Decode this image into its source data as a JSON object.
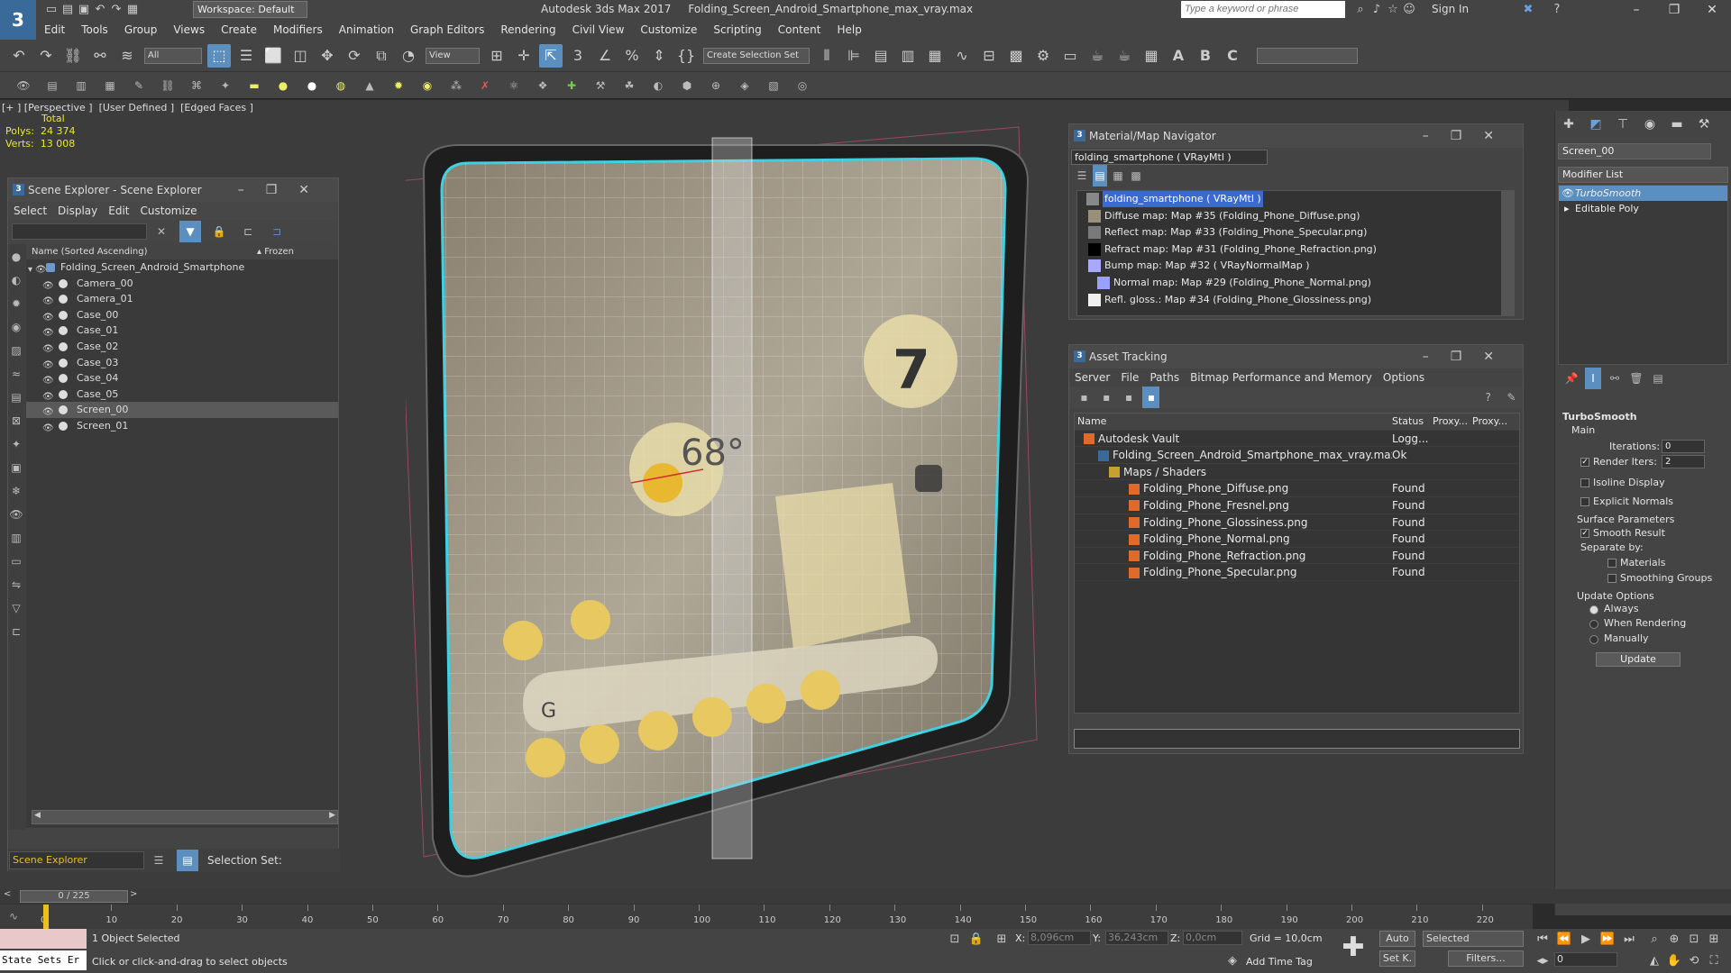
{
  "app": {
    "title": "Autodesk 3ds Max 2017     Folding_Screen_Android_Smartphone_max_vray.max",
    "logo": "3",
    "workspace": "Workspace: Default",
    "search_placeholder": "Type a keyword or phrase",
    "sign_in": "Sign In",
    "accent": "#5b8fbf"
  },
  "menu": [
    "Edit",
    "Tools",
    "Group",
    "Views",
    "Create",
    "Modifiers",
    "Animation",
    "Graph Editors",
    "Rendering",
    "Civil View",
    "Customize",
    "Scripting",
    "Content",
    "Help"
  ],
  "toolbar": {
    "filter": "All",
    "view": "View",
    "selection_set": "Create Selection Set"
  },
  "viewport": {
    "label": "[+ ] [Perspective ]  [User Defined ]  [Edged Faces ]",
    "stats_total": "Total",
    "polys_label": "Polys:",
    "polys_value": "24 374",
    "verts_label": "Verts:",
    "verts_value": "13 008",
    "screen": {
      "temp": "68°",
      "clock": "7",
      "search_g": "G"
    }
  },
  "scene_explorer": {
    "title": "Scene Explorer - Scene Explorer",
    "menu": [
      "Select",
      "Display",
      "Edit",
      "Customize"
    ],
    "col_name": "Name (Sorted Ascending)",
    "col_frozen": "▴ Frozen",
    "root": "Folding_Screen_Android_Smartphone",
    "items": [
      "Camera_00",
      "Camera_01",
      "Case_00",
      "Case_01",
      "Case_02",
      "Case_03",
      "Case_04",
      "Case_05",
      "Screen_00",
      "Screen_01"
    ],
    "selected_item": "Screen_00",
    "footer_label": "Scene Explorer",
    "selection_set_label": "Selection Set:"
  },
  "material_navigator": {
    "title": "Material/Map Navigator",
    "material_field": "folding_smartphone  ( VRayMtl )",
    "root": "folding_smartphone  ( VRayMtl )",
    "items": [
      {
        "text": "Diffuse map: Map #35 (Folding_Phone_Diffuse.png)",
        "swatch": "#9a8f7a"
      },
      {
        "text": "Reflect map: Map #33 (Folding_Phone_Specular.png)",
        "swatch": "#7a7a7a"
      },
      {
        "text": "Refract map: Map #31 (Folding_Phone_Refraction.png)",
        "swatch": "#000000"
      },
      {
        "text": "Bump map: Map #32  ( VRayNormalMap )",
        "swatch": "#a8a8ff"
      },
      {
        "text": "Normal map: Map #29 (Folding_Phone_Normal.png)",
        "swatch": "#9aa0ff"
      },
      {
        "text": "Refl. gloss.: Map #34 (Folding_Phone_Glossiness.png)",
        "swatch": "#f0f0f0"
      }
    ]
  },
  "asset_tracking": {
    "title": "Asset Tracking",
    "menu": [
      "Server",
      "File",
      "Paths",
      "Bitmap Performance and Memory",
      "Options"
    ],
    "columns": [
      "Name",
      "Status",
      "Proxy...",
      "Proxy..."
    ],
    "rows": [
      {
        "name": "Autodesk Vault",
        "status": "Logg...",
        "indent": 0
      },
      {
        "name": "Folding_Screen_Android_Smartphone_max_vray.max",
        "status": "Ok",
        "indent": 1
      },
      {
        "name": "Maps / Shaders",
        "status": "",
        "indent": 2
      },
      {
        "name": "Folding_Phone_Diffuse.png",
        "status": "Found",
        "indent": 3
      },
      {
        "name": "Folding_Phone_Fresnel.png",
        "status": "Found",
        "indent": 3
      },
      {
        "name": "Folding_Phone_Glossiness.png",
        "status": "Found",
        "indent": 3
      },
      {
        "name": "Folding_Phone_Normal.png",
        "status": "Found",
        "indent": 3
      },
      {
        "name": "Folding_Phone_Refraction.png",
        "status": "Found",
        "indent": 3
      },
      {
        "name": "Folding_Phone_Specular.png",
        "status": "Found",
        "indent": 3
      }
    ]
  },
  "command_panel": {
    "object_name": "Screen_00",
    "modifier_list": "Modifier List",
    "stack": [
      "TurboSmooth",
      "Editable Poly"
    ],
    "turbosmooth": {
      "title": "TurboSmooth",
      "main": "Main",
      "iterations_label": "Iterations:",
      "iterations_value": "0",
      "render_iters_label": "Render Iters:",
      "render_iters_value": "2",
      "isoline": "Isoline Display",
      "explicit_normals": "Explicit Normals",
      "surface_params": "Surface Parameters",
      "smooth_result": "Smooth Result",
      "separate_by": "Separate by:",
      "materials": "Materials",
      "smoothing_groups": "Smoothing Groups",
      "update_options": "Update Options",
      "always": "Always",
      "when_rendering": "When Rendering",
      "manually": "Manually",
      "update": "Update"
    }
  },
  "timeline": {
    "frame": "0 / 225",
    "ticks": [
      "0",
      "10",
      "20",
      "30",
      "40",
      "50",
      "60",
      "70",
      "80",
      "90",
      "100",
      "110",
      "120",
      "130",
      "140",
      "150",
      "160",
      "170",
      "180",
      "190",
      "200",
      "210",
      "220"
    ]
  },
  "status": {
    "maxscript": "State Sets Er",
    "selected": "1 Object Selected",
    "prompt": "Click or click-and-drag to select objects",
    "x_label": "X:",
    "x_value": "8,096cm",
    "y_label": "Y:",
    "y_value": "36,243cm",
    "z_label": "Z:",
    "z_value": "0,0cm",
    "grid": "Grid = 10,0cm",
    "add_time_tag": "Add Time Tag",
    "auto": "Auto",
    "set_key": "Set K.",
    "selected_dropdown": "Selected",
    "filters": "Filters...",
    "frame_value": "0"
  }
}
